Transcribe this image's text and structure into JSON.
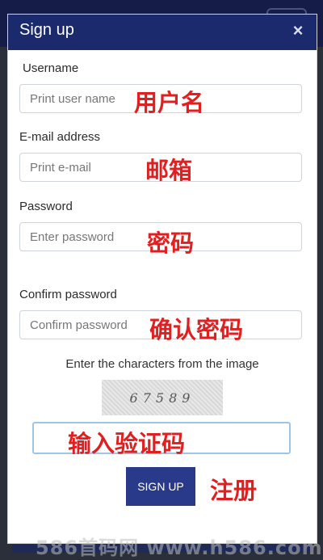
{
  "modal": {
    "title": "Sign up",
    "close_icon": "×"
  },
  "form": {
    "username": {
      "label": "Username",
      "placeholder": "Print user name",
      "annotation": "用户名"
    },
    "email": {
      "label": "E-mail address",
      "placeholder": "Print e-mail",
      "annotation": "邮箱"
    },
    "password": {
      "label": "Password",
      "placeholder": "Enter password",
      "annotation": "密码"
    },
    "confirm_password": {
      "label": "Confirm password",
      "placeholder": "Confirm password",
      "annotation": "确认密码"
    },
    "captcha": {
      "prompt": "Enter the characters from the image",
      "image_text": "67589",
      "annotation": "输入验证码"
    },
    "submit": {
      "label": "SIGN UP",
      "annotation": "注册"
    }
  },
  "watermark": "586首码网 www.h586.com",
  "icons": {
    "close": "close-icon",
    "menu": "hamburger-menu-icon"
  }
}
